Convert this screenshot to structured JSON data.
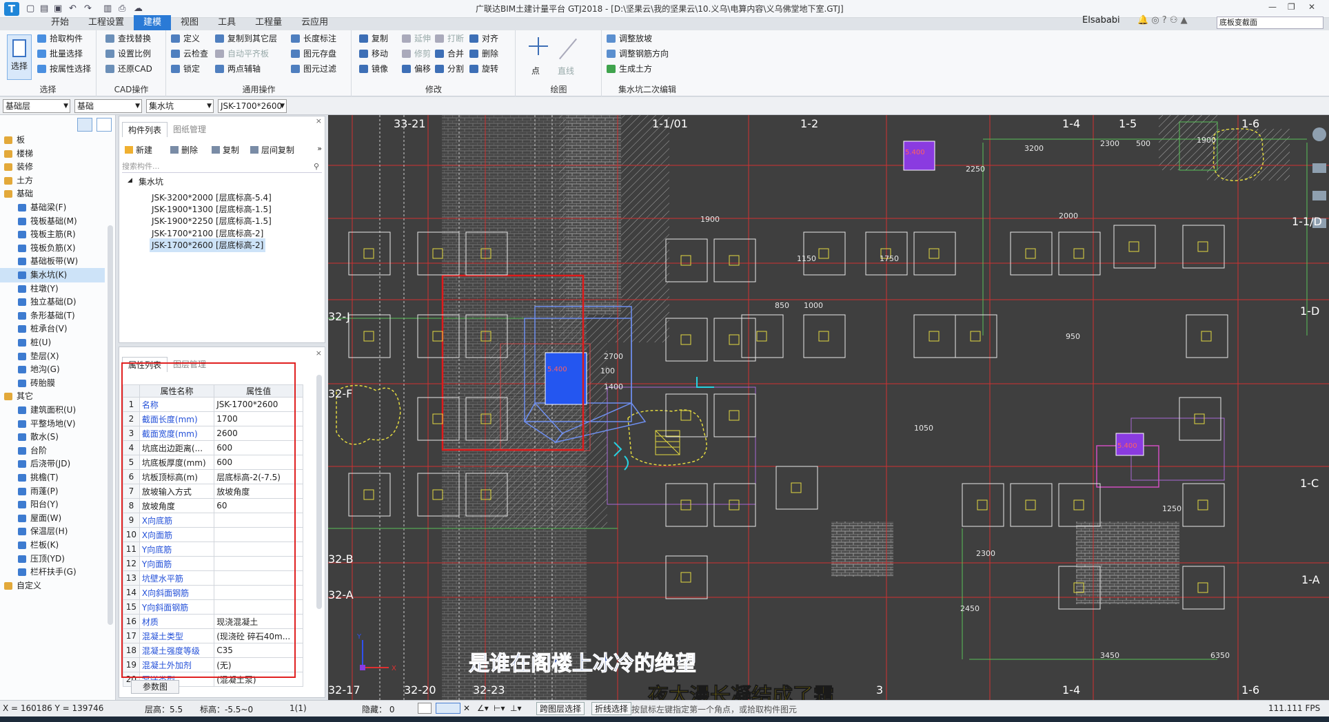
{
  "titlebar": {
    "logo": "T",
    "window_title": "广联达BIM土建计量平台 GTJ2018 - [D:\\坚果云\\我的坚果云\\10.义乌\\电算内容\\义乌佛堂地下室.GTJ]",
    "user": "Elsababi",
    "search_placeholder": "底板变截面"
  },
  "menus": [
    "开始",
    "工程设置",
    "建模",
    "视图",
    "工具",
    "工程量",
    "云应用"
  ],
  "ribbon": {
    "select": {
      "big": "选择",
      "items": [
        "拾取构件",
        "批量选择",
        "按属性选择"
      ],
      "title": "选择"
    },
    "cad": {
      "items": [
        "查找替换",
        "设置比例",
        "还原CAD"
      ],
      "title": "CAD操作"
    },
    "general": {
      "items": [
        "定义",
        "复制到其它层",
        "长度标注",
        "云检查",
        "自动平齐板",
        "图元存盘",
        "锁定",
        "两点辅轴",
        "图元过滤"
      ],
      "title": "通用操作"
    },
    "modify": {
      "items": [
        "复制",
        "延伸",
        "打断",
        "对齐",
        "移动",
        "修剪",
        "合并",
        "删除",
        "镜像",
        "偏移",
        "分割",
        "旋转"
      ],
      "title": "修改"
    },
    "draw": {
      "items": [
        "点",
        "直线"
      ],
      "title": "绘图"
    },
    "pit": {
      "items": [
        "调整放坡",
        "调整钢筋方向",
        "生成土方"
      ],
      "title": "集水坑二次编辑"
    }
  },
  "selectors": [
    "基础层",
    "基础",
    "集水坑",
    "JSK-1700*2600"
  ],
  "nav": [
    {
      "label": "板",
      "type": "folder"
    },
    {
      "label": "楼梯",
      "type": "folder"
    },
    {
      "label": "装修",
      "type": "folder"
    },
    {
      "label": "土方",
      "type": "folder"
    },
    {
      "label": "基础",
      "type": "folder-open"
    },
    {
      "label": "基础梁(F)",
      "type": "item"
    },
    {
      "label": "筏板基础(M)",
      "type": "item"
    },
    {
      "label": "筏板主筋(R)",
      "type": "item"
    },
    {
      "label": "筏板负筋(X)",
      "type": "item"
    },
    {
      "label": "基础板带(W)",
      "type": "item"
    },
    {
      "label": "集水坑(K)",
      "type": "item",
      "selected": true
    },
    {
      "label": "柱墩(Y)",
      "type": "item"
    },
    {
      "label": "独立基础(D)",
      "type": "item"
    },
    {
      "label": "条形基础(T)",
      "type": "item"
    },
    {
      "label": "桩承台(V)",
      "type": "item"
    },
    {
      "label": "桩(U)",
      "type": "item"
    },
    {
      "label": "垫层(X)",
      "type": "item"
    },
    {
      "label": "地沟(G)",
      "type": "item"
    },
    {
      "label": "砖胎膜",
      "type": "item"
    },
    {
      "label": "其它",
      "type": "folder-open"
    },
    {
      "label": "建筑面积(U)",
      "type": "item"
    },
    {
      "label": "平整场地(V)",
      "type": "item"
    },
    {
      "label": "散水(S)",
      "type": "item"
    },
    {
      "label": "台阶",
      "type": "item"
    },
    {
      "label": "后浇带(JD)",
      "type": "item"
    },
    {
      "label": "挑檐(T)",
      "type": "item"
    },
    {
      "label": "雨蓬(P)",
      "type": "item"
    },
    {
      "label": "阳台(Y)",
      "type": "item"
    },
    {
      "label": "屋面(W)",
      "type": "item"
    },
    {
      "label": "保温层(H)",
      "type": "item"
    },
    {
      "label": "栏板(K)",
      "type": "item"
    },
    {
      "label": "压顶(YD)",
      "type": "item"
    },
    {
      "label": "栏杆扶手(G)",
      "type": "item"
    },
    {
      "label": "自定义",
      "type": "folder"
    }
  ],
  "components": {
    "tabs": [
      "构件列表",
      "图纸管理"
    ],
    "toolbar": [
      "新建",
      "删除",
      "复制",
      "层间复制"
    ],
    "search_placeholder": "搜索构件...",
    "root": "集水坑",
    "items": [
      "JSK-3200*2000 [层底标高-5.4]",
      "JSK-1900*1300 [层底标高-1.5]",
      "JSK-1900*2250 [层底标高-1.5]",
      "JSK-1700*2100 [层底标高-2]",
      "JSK-1700*2600 [层底标高-2]"
    ],
    "selected_index": 4
  },
  "properties": {
    "tabs": [
      "属性列表",
      "图层管理"
    ],
    "col_name": "属性名称",
    "col_value": "属性值",
    "rows": [
      {
        "n": "1",
        "name": "名称",
        "value": "JSK-1700*2600",
        "blue": true
      },
      {
        "n": "2",
        "name": "截面长度(mm)",
        "value": "1700",
        "blue": true
      },
      {
        "n": "3",
        "name": "截面宽度(mm)",
        "value": "2600",
        "blue": true
      },
      {
        "n": "4",
        "name": "坑底出边距离(...",
        "value": "600",
        "blue": false
      },
      {
        "n": "5",
        "name": "坑底板厚度(mm)",
        "value": "600",
        "blue": false
      },
      {
        "n": "6",
        "name": "坑板顶标高(m)",
        "value": "层底标高-2(-7.5)",
        "blue": false
      },
      {
        "n": "7",
        "name": "放坡输入方式",
        "value": "放坡角度",
        "blue": false
      },
      {
        "n": "8",
        "name": "放坡角度",
        "value": "60",
        "blue": false
      },
      {
        "n": "9",
        "name": "X向底筋",
        "value": "",
        "blue": true
      },
      {
        "n": "10",
        "name": "X向面筋",
        "value": "",
        "blue": true
      },
      {
        "n": "11",
        "name": "Y向底筋",
        "value": "",
        "blue": true
      },
      {
        "n": "12",
        "name": "Y向面筋",
        "value": "",
        "blue": true
      },
      {
        "n": "13",
        "name": "坑壁水平筋",
        "value": "",
        "blue": true
      },
      {
        "n": "14",
        "name": "X向斜面钢筋",
        "value": "",
        "blue": true
      },
      {
        "n": "15",
        "name": "Y向斜面钢筋",
        "value": "",
        "blue": true
      },
      {
        "n": "16",
        "name": "材质",
        "value": "现浇混凝土",
        "blue": true
      },
      {
        "n": "17",
        "name": "混凝土类型",
        "value": "(现浇砼 碎石40m...",
        "blue": true
      },
      {
        "n": "18",
        "name": "混凝土强度等级",
        "value": "C35",
        "blue": true
      },
      {
        "n": "19",
        "name": "混凝土外加剂",
        "value": "(无)",
        "blue": true
      },
      {
        "n": "20",
        "name": "泵送类型",
        "value": "(混凝土泵)",
        "blue": true
      }
    ],
    "param_button": "参数图"
  },
  "canvas": {
    "axis_labels": [
      "33-21",
      "1-1/01",
      "1-2",
      "1-4",
      "1-5",
      "1-6",
      "32-J",
      "32-F",
      "32-B",
      "32-A",
      "1-1/D",
      "1-D",
      "1-C",
      "1-A",
      "32-17",
      "32-20",
      "32-23",
      "3",
      "1-4",
      "1-6"
    ],
    "pit_elevations": [
      "5.400",
      "5.400",
      "5.400"
    ],
    "dims": [
      "3200",
      "2300",
      "500",
      "1900",
      "2700",
      "1400",
      "100",
      "3450",
      "6350",
      "2450",
      "2300",
      "1150",
      "1750",
      "2000",
      "950",
      "1050",
      "850",
      "1000",
      "1900",
      "1250",
      "2250"
    ]
  },
  "subtitles": [
    "是谁在阁楼上冰冷的绝望",
    "夜太漫长凝结成了霜"
  ],
  "status": {
    "coords": "X = 160186 Y = 139746",
    "floor_height": "层高：5.5",
    "elevation": "标高：-5.5~0",
    "selection": "1(1)",
    "hidden": "隐藏： 0",
    "cross_layer": "跨图层选择",
    "polyline": "折线选择",
    "hint": "按鼠标左键指定第一个角点，或拾取构件图元",
    "fps": "111.111 FPS"
  }
}
